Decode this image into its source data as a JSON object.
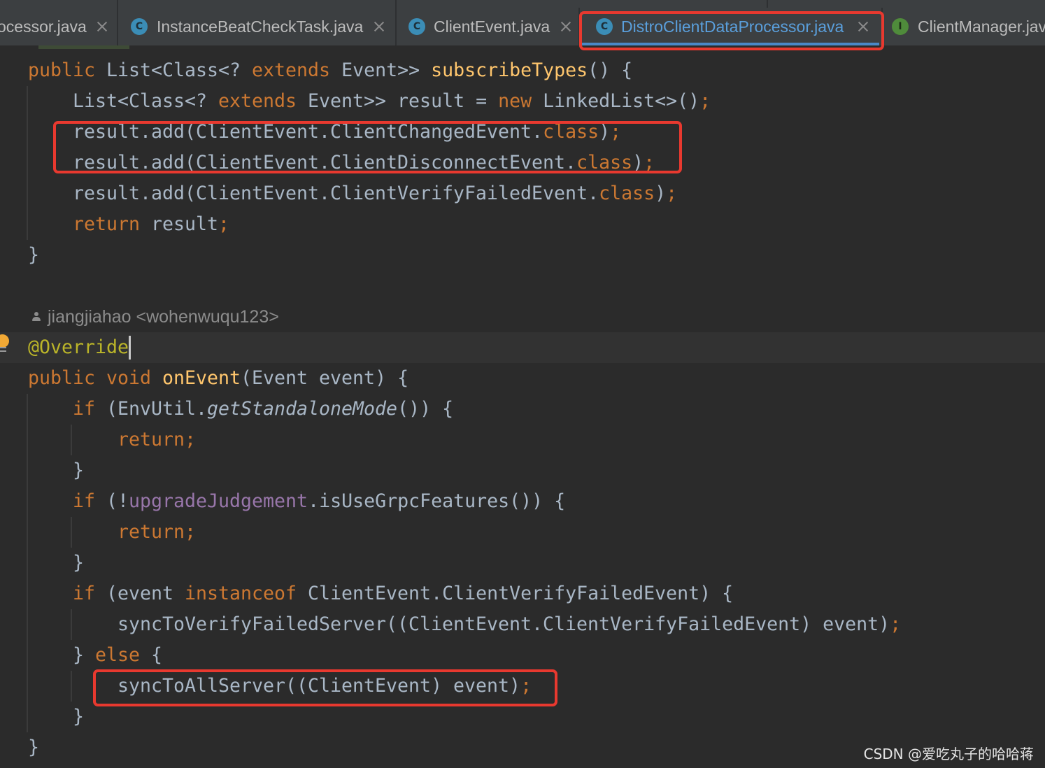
{
  "tabs": [
    {
      "label": "ocessor.java",
      "close_icon": "close-icon"
    },
    {
      "label": "InstanceBeatCheckTask.java",
      "icon": "class-icon",
      "icon_letter": "C",
      "close_icon": "close-icon"
    },
    {
      "label": "ClientEvent.java",
      "icon": "class-icon",
      "icon_letter": "C",
      "close_icon": "close-icon"
    },
    {
      "label": "DistroClientDataProcessor.java",
      "icon": "class-icon",
      "icon_letter": "C",
      "close_icon": "close-icon",
      "active": true
    },
    {
      "label": "ClientManager.jav",
      "icon": "interface-icon",
      "icon_letter": "I"
    }
  ],
  "editor": {
    "gutter_icon": "intention-bulb-icon",
    "author_hint": {
      "icon": "person-icon",
      "text": "jiangjiahao <wohenwuqu123>"
    },
    "lines": [
      [
        "public",
        " List<Class<? ",
        "extends",
        " Event>> ",
        "subscribeTypes",
        "() {"
      ],
      [
        "List<Class<? ",
        "extends",
        " Event>> result = ",
        "new",
        " LinkedList<>()",
        ";"
      ],
      [
        "result.add(ClientEvent.ClientChangedEvent.",
        "class",
        ")",
        ";"
      ],
      [
        "result.add(ClientEvent.ClientDisconnectEvent.",
        "class",
        ")",
        ";"
      ],
      [
        "result.add(ClientEvent.ClientVerifyFailedEvent.",
        "class",
        ")",
        ";"
      ],
      [
        "return",
        " result",
        ";"
      ],
      [
        "}"
      ],
      [
        "@Override"
      ],
      [
        "public void ",
        "onEvent",
        "(Event event) {"
      ],
      [
        "if",
        " (EnvUtil.",
        "getStandaloneMode",
        "()) {"
      ],
      [
        "return;"
      ],
      [
        "}"
      ],
      [
        "if",
        " (!",
        "upgradeJudgement",
        ".isUseGrpcFeatures()) {"
      ],
      [
        "return;"
      ],
      [
        "}"
      ],
      [
        "if",
        " (event ",
        "instanceof",
        " ClientEvent.ClientVerifyFailedEvent) {"
      ],
      [
        "syncToVerifyFailedServer((ClientEvent.ClientVerifyFailedEvent) event)",
        ";"
      ],
      [
        "} ",
        "else",
        " {"
      ],
      [
        "syncToAllServer((ClientEvent) event)",
        ";"
      ],
      [
        "}"
      ],
      [
        "}"
      ]
    ]
  },
  "watermark": "CSDN @爱吃丸子的哈哈蒋",
  "colors": {
    "editor_bg": "#2b2b2b",
    "tab_bar_bg": "#3c3f41",
    "current_line_bg": "#323232",
    "keyword": "#cc7832",
    "text": "#a9b7c6",
    "method_declaration": "#ffc66d",
    "annotation": "#bbb529",
    "field": "#9876aa",
    "active_tab_text": "#5a9fdc",
    "active_tab_underline": "#4a88c7",
    "highlight_box": "#e8392f"
  }
}
